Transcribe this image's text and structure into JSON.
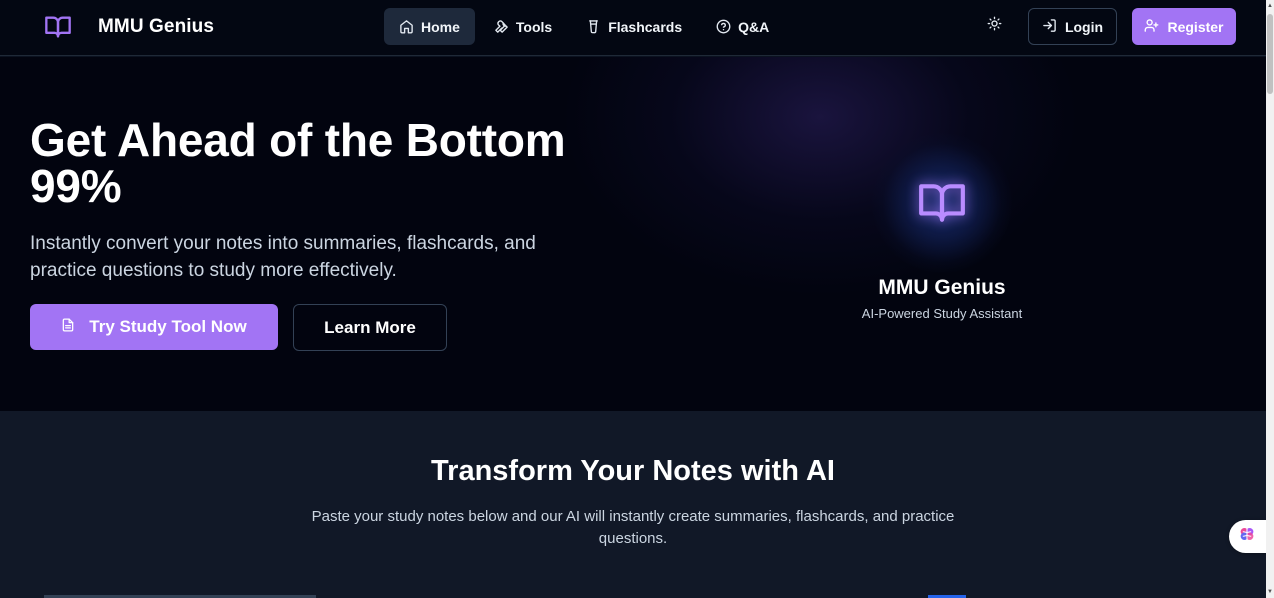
{
  "brand": {
    "name": "MMU Genius",
    "icon": "book-open-icon"
  },
  "nav": {
    "links": [
      {
        "label": "Home",
        "icon": "home-icon",
        "active": true
      },
      {
        "label": "Tools",
        "icon": "wrench-icon",
        "active": false
      },
      {
        "label": "Flashcards",
        "icon": "flashcard-icon",
        "active": false
      },
      {
        "label": "Q&A",
        "icon": "help-circle-icon",
        "active": false
      }
    ],
    "theme_toggle_icon": "sun-icon",
    "login_label": "Login",
    "register_label": "Register"
  },
  "hero": {
    "title": "Get Ahead of the Bottom 99%",
    "subtitle": "Instantly convert your notes into summaries, flashcards, and practice questions to study more effectively.",
    "primary_button": "Try Study Tool Now",
    "secondary_button": "Learn More",
    "logo_name": "MMU Genius",
    "logo_tagline": "AI-Powered Study Assistant"
  },
  "transform": {
    "title": "Transform Your Notes with AI",
    "description": "Paste your study notes below and our AI will instantly create summaries, flashcards, and practice questions."
  },
  "colors": {
    "accent": "#a274f4",
    "nav_background": "#030712",
    "hero_background": "#02040f",
    "section_background": "#111827"
  }
}
